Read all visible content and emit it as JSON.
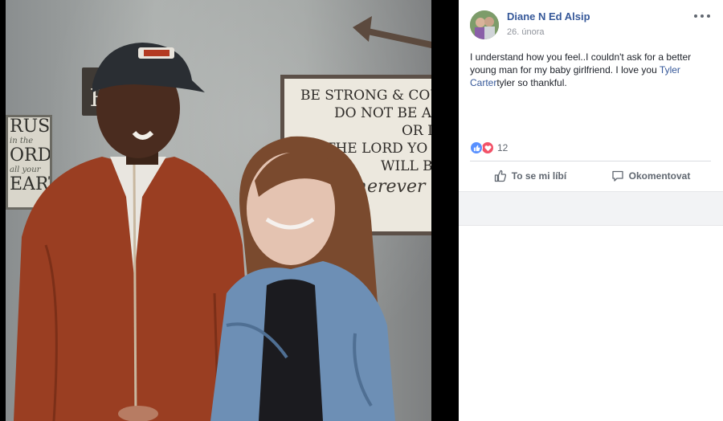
{
  "post": {
    "author": "Diane N Ed Alsip",
    "timestamp": "26. února",
    "text_before": "I understand how you feel..I couldn't ask for a better young man for my baby girlfriend. I love you ",
    "mention": "Tyler Carter",
    "text_after": "tyler so thankful."
  },
  "reactions": {
    "icons": [
      "like-icon",
      "love-icon"
    ],
    "count": "12"
  },
  "actions": {
    "like_label": "To se mi líbí",
    "comment_label": "Okomentovat"
  },
  "colors": {
    "link": "#365899",
    "like": "#5890ff",
    "love": "#f25268",
    "muted": "#90949c"
  }
}
